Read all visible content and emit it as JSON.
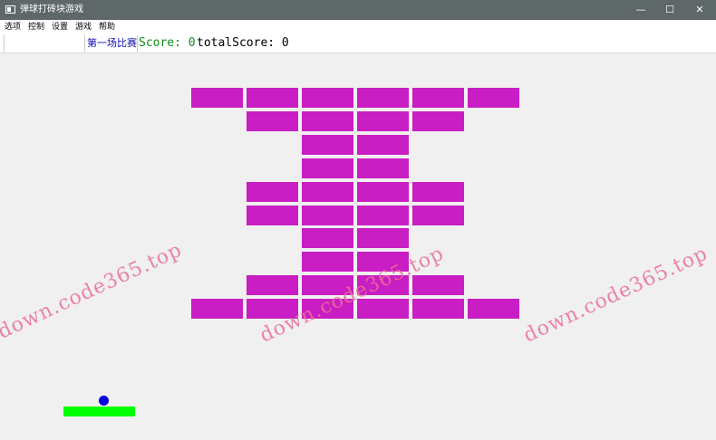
{
  "window": {
    "title": "弹球打砖块游戏",
    "minimize": "—",
    "maximize": "☐",
    "close": "✕"
  },
  "menu": {
    "items": [
      "选项",
      "控制",
      "设置",
      "游戏",
      "帮助"
    ]
  },
  "status": {
    "round": "第一场比赛",
    "score_label": "Score: 0",
    "total_label": "totalScore: 0"
  },
  "bricks": {
    "rows": [
      [
        1,
        1,
        1,
        1,
        1,
        1
      ],
      [
        0,
        1,
        1,
        1,
        1,
        0
      ],
      [
        0,
        0,
        1,
        1,
        0,
        0
      ],
      [
        0,
        0,
        1,
        1,
        0,
        0
      ],
      [
        0,
        1,
        1,
        1,
        1,
        0
      ],
      [
        0,
        1,
        1,
        1,
        1,
        0
      ],
      [
        0,
        0,
        1,
        1,
        0,
        0
      ],
      [
        0,
        0,
        1,
        1,
        0,
        0
      ],
      [
        0,
        1,
        1,
        1,
        1,
        0
      ],
      [
        1,
        1,
        1,
        1,
        1,
        1
      ]
    ],
    "color": "#c81ec3"
  },
  "paddle": {
    "color": "#00ff00"
  },
  "ball": {
    "color": "#0000dd"
  },
  "watermark": "down.code365.top"
}
